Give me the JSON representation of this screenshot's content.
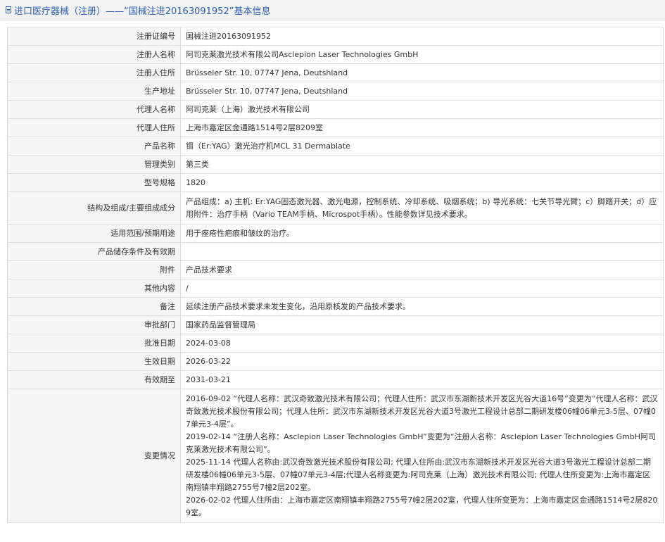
{
  "header": {
    "title": "进口医疗器械（注册）——“国械注进20163091952”基本信息"
  },
  "rows": [
    {
      "label": "注册证编号",
      "value": "国械注进20163091952"
    },
    {
      "label": "注册人名称",
      "value": "阿司克莱激光技术有限公司Asclepion Laser Technologies GmbH"
    },
    {
      "label": "注册人住所",
      "value": "Brüsseler Str. 10, 07747 Jena, Deutshland"
    },
    {
      "label": "生产地址",
      "value": "Brüsseler Str. 10, 07747 Jena, Deutshland"
    },
    {
      "label": "代理人名称",
      "value": "阿司克莱（上海）激光技术有限公司"
    },
    {
      "label": "代理人住所",
      "value": "上海市嘉定区金通路1514号2层8209室"
    },
    {
      "label": "产品名称",
      "value": "铒（Er:YAG）激光治疗机MCL 31 Dermablate"
    },
    {
      "label": "管理类别",
      "value": "第三类"
    },
    {
      "label": "型号规格",
      "value": "1820"
    },
    {
      "label": "结构及组成/主要组成成分",
      "value": "产品组成：a) 主机: Er:YAG固态激光器、激光电源，控制系统、冷却系统、吸烟系统；b) 导光系统：七关节导光臂；c）脚踏开关；d）应用附件：治疗手柄（Vario TEAM手柄、Microspot手柄）。性能参数详见技术要求。"
    },
    {
      "label": "适用范围/预期用途",
      "value": "用于痤疮性疤痕和皱纹的治疗。"
    },
    {
      "label": "产品储存条件及有效期",
      "value": ""
    },
    {
      "label": "附件",
      "value": "产品技术要求"
    },
    {
      "label": "其他内容",
      "value": "/"
    },
    {
      "label": "备注",
      "value": "延续注册产品技术要求未发生变化，沿用原核发的产品技术要求。"
    },
    {
      "label": "审批部门",
      "value": "国家药品监督管理局"
    },
    {
      "label": "批准日期",
      "value": "2024-03-08"
    },
    {
      "label": "生效日期",
      "value": "2026-03-22"
    },
    {
      "label": "有效期至",
      "value": "2031-03-21"
    }
  ],
  "changes": {
    "label": "变更情况",
    "entries": [
      "2016-09-02 “代理人名称：武汉奇致激光技术有限公司；代理人住所：武汉市东湖新技术开发区光谷大道16号”变更为“代理人名称：武汉奇致激光技术股份有限公司；代理人住所：武汉市东湖新技术开发区光谷大道3号激光工程设计总部二期研发楼06幢06单元3-5层、07幢07单元3-4层”。",
      "2019-02-14 “注册人名称：Asclepion Laser Technologies GmbH”变更为“注册人名称：Asclepion Laser Technologies GmbH阿司克莱激光技术有限公司”。",
      "2025-11-14 代理人名称由:武汉奇致激光技术股份有限公司; 代理人住所由:武汉市东湖新技术开发区光谷大道3号激光工程设计总部二期研发楼06幢06单元3-5层、07幢07单元3-4层;代理人名称变更为:阿司克莱（上海）激光技术有限公司; 代理人住所变更为:上海市嘉定区南翔镇丰翔路2755号7幢2层202室。",
      "2026-02-02 代理人住所由：上海市嘉定区南翔镇丰翔路2755号7幢2层202室，代理人住所变更为：上海市嘉定区金通路1514号2层8209室。"
    ]
  }
}
